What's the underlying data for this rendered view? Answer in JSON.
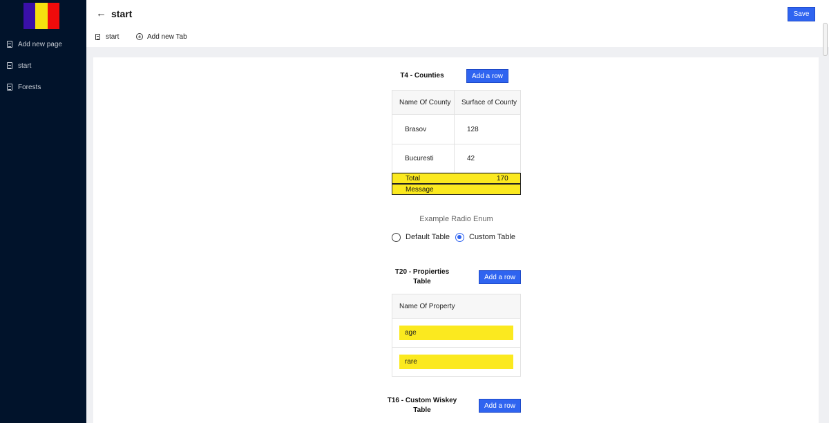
{
  "sidebar": {
    "flag_colors": [
      "#3a10a8",
      "#f5e00f",
      "#ef0b0b"
    ],
    "items": [
      {
        "label": "Add new page"
      },
      {
        "label": "start"
      },
      {
        "label": "Forests"
      }
    ]
  },
  "header": {
    "title": "start",
    "save_label": "Save",
    "tabs": [
      {
        "label": "start"
      },
      {
        "label": "Add new Tab"
      }
    ]
  },
  "t4": {
    "title": "T4 - Counties",
    "add_label": "Add a row",
    "columns": [
      "Name Of County",
      "Surface of County"
    ],
    "rows": [
      [
        "Brasov",
        "128"
      ],
      [
        "Bucuresti",
        "42"
      ]
    ],
    "total_label": "Total",
    "total_value": "170",
    "message_label": "Message"
  },
  "radio": {
    "title": "Example Radio Enum",
    "options": [
      "Default Table",
      "Custom Table"
    ],
    "selected": "Custom Table"
  },
  "t20": {
    "title_line1": "T20 - Propierties",
    "title_line2": "Table",
    "add_label": "Add a row",
    "column": "Name Of Property",
    "values": [
      "age",
      "rare"
    ]
  },
  "t16": {
    "title_line1": "T16 - Custom Wiskey",
    "title_line2": "Table",
    "add_label": "Add a row"
  },
  "colors": {
    "sidebar_bg": "#01132b",
    "accent": "#2f64f0",
    "highlight": "#fbe91f",
    "content_bg": "#eff0f3"
  }
}
